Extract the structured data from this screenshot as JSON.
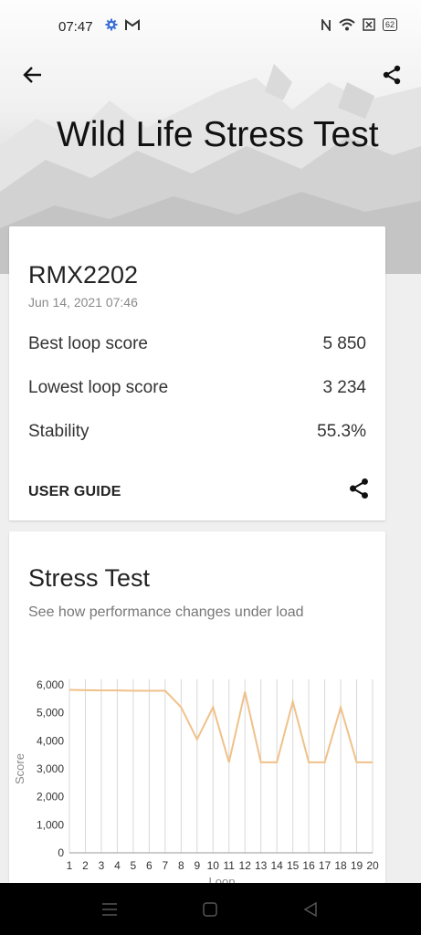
{
  "status_bar": {
    "time": "07:47",
    "battery": "62"
  },
  "header": {
    "title": "Wild Life Stress Test"
  },
  "summary": {
    "device": "RMX2202",
    "date": "Jun 14, 2021 07:46",
    "rows": [
      {
        "label": "Best loop score",
        "value": "5 850"
      },
      {
        "label": "Lowest loop score",
        "value": "3 234"
      },
      {
        "label": "Stability",
        "value": "55.3%"
      }
    ],
    "user_guide": "USER GUIDE"
  },
  "stress": {
    "title": "Stress Test",
    "subtitle": "See how performance changes under load"
  },
  "chart_data": {
    "type": "line",
    "xlabel": "Loop",
    "ylabel": "Score",
    "x": [
      1,
      2,
      3,
      4,
      5,
      6,
      7,
      8,
      9,
      10,
      11,
      12,
      13,
      14,
      15,
      16,
      17,
      18,
      19,
      20
    ],
    "values": [
      5820,
      5810,
      5800,
      5800,
      5790,
      5790,
      5790,
      5200,
      4050,
      5200,
      3234,
      5750,
      3234,
      3234,
      5400,
      3234,
      3234,
      5200,
      3234,
      3234
    ],
    "ylim": [
      0,
      6000
    ],
    "yticks": [
      "0",
      "1,000",
      "2,000",
      "3,000",
      "4,000",
      "5,000",
      "6,000"
    ],
    "grid": true,
    "line_color": "#f0c18a"
  }
}
